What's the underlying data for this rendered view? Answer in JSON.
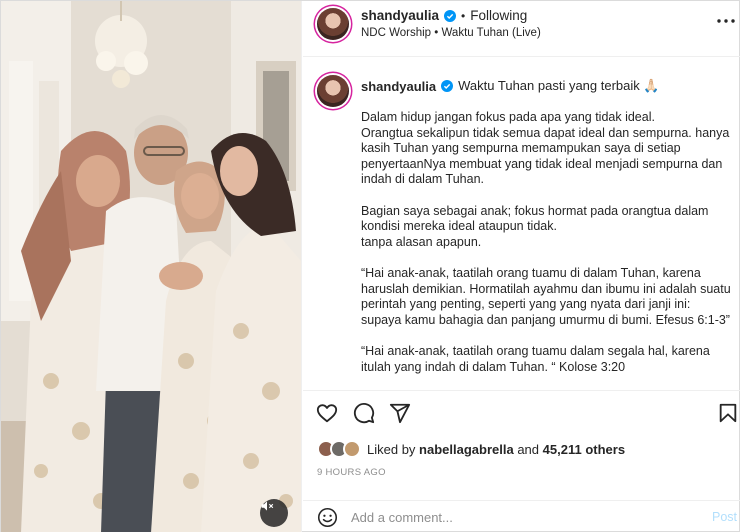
{
  "post": {
    "username": "shandyaulia",
    "following_label": "Following",
    "separator": "•",
    "audio": "NDC Worship • Waktu Tuhan (Live)",
    "caption_title": "Waktu Tuhan pasti yang terbaik 🙏🏻",
    "caption_paragraphs": [
      "Dalam hidup jangan fokus pada apa yang tidak ideal.\nOrangtua sekalipun tidak semua dapat ideal dan sempurna. hanya kasih Tuhan yang sempurna memampukan saya di setiap penyertaanNya membuat yang tidak ideal menjadi sempurna dan indah di dalam Tuhan.",
      "Bagian saya sebagai anak; fokus hormat pada orangtua dalam kondisi mereka ideal ataupun tidak.\ntanpa alasan apapun.",
      "“Hai anak-anak, taatilah orang tuamu di dalam Tuhan, karena haruslah demikian. Hormatilah ayahmu dan ibumu ini adalah suatu perintah yang penting, seperti yang yang nyata dari janji ini: supaya kamu bahagia dan panjang umurmu di bumi. Efesus 6:1-3”",
      "“Hai anak-anak, taatilah orang tuamu dalam segala hal, karena itulah yang indah di dalam Tuhan. “ Kolose 3:20"
    ],
    "liked_by_prefix": "Liked by",
    "liked_by_user": "nabellagabrella",
    "liked_by_and": "and",
    "likes_count": "45,211 others",
    "timestamp": "9 HOURS AGO",
    "comment_placeholder": "Add a comment...",
    "post_label": "Post"
  },
  "icons": {
    "verified": "verified-badge-icon",
    "more": "more-options-icon",
    "like": "heart-icon",
    "comment": "comment-icon",
    "share": "share-icon",
    "save": "bookmark-icon",
    "emoji": "emoji-icon",
    "mute": "muted-speaker-icon"
  },
  "colors": {
    "accent_blue": "#0095f6",
    "post_disabled": "#b2dffc",
    "muted_text": "#8e8e8e",
    "border": "#dbdbdb"
  }
}
